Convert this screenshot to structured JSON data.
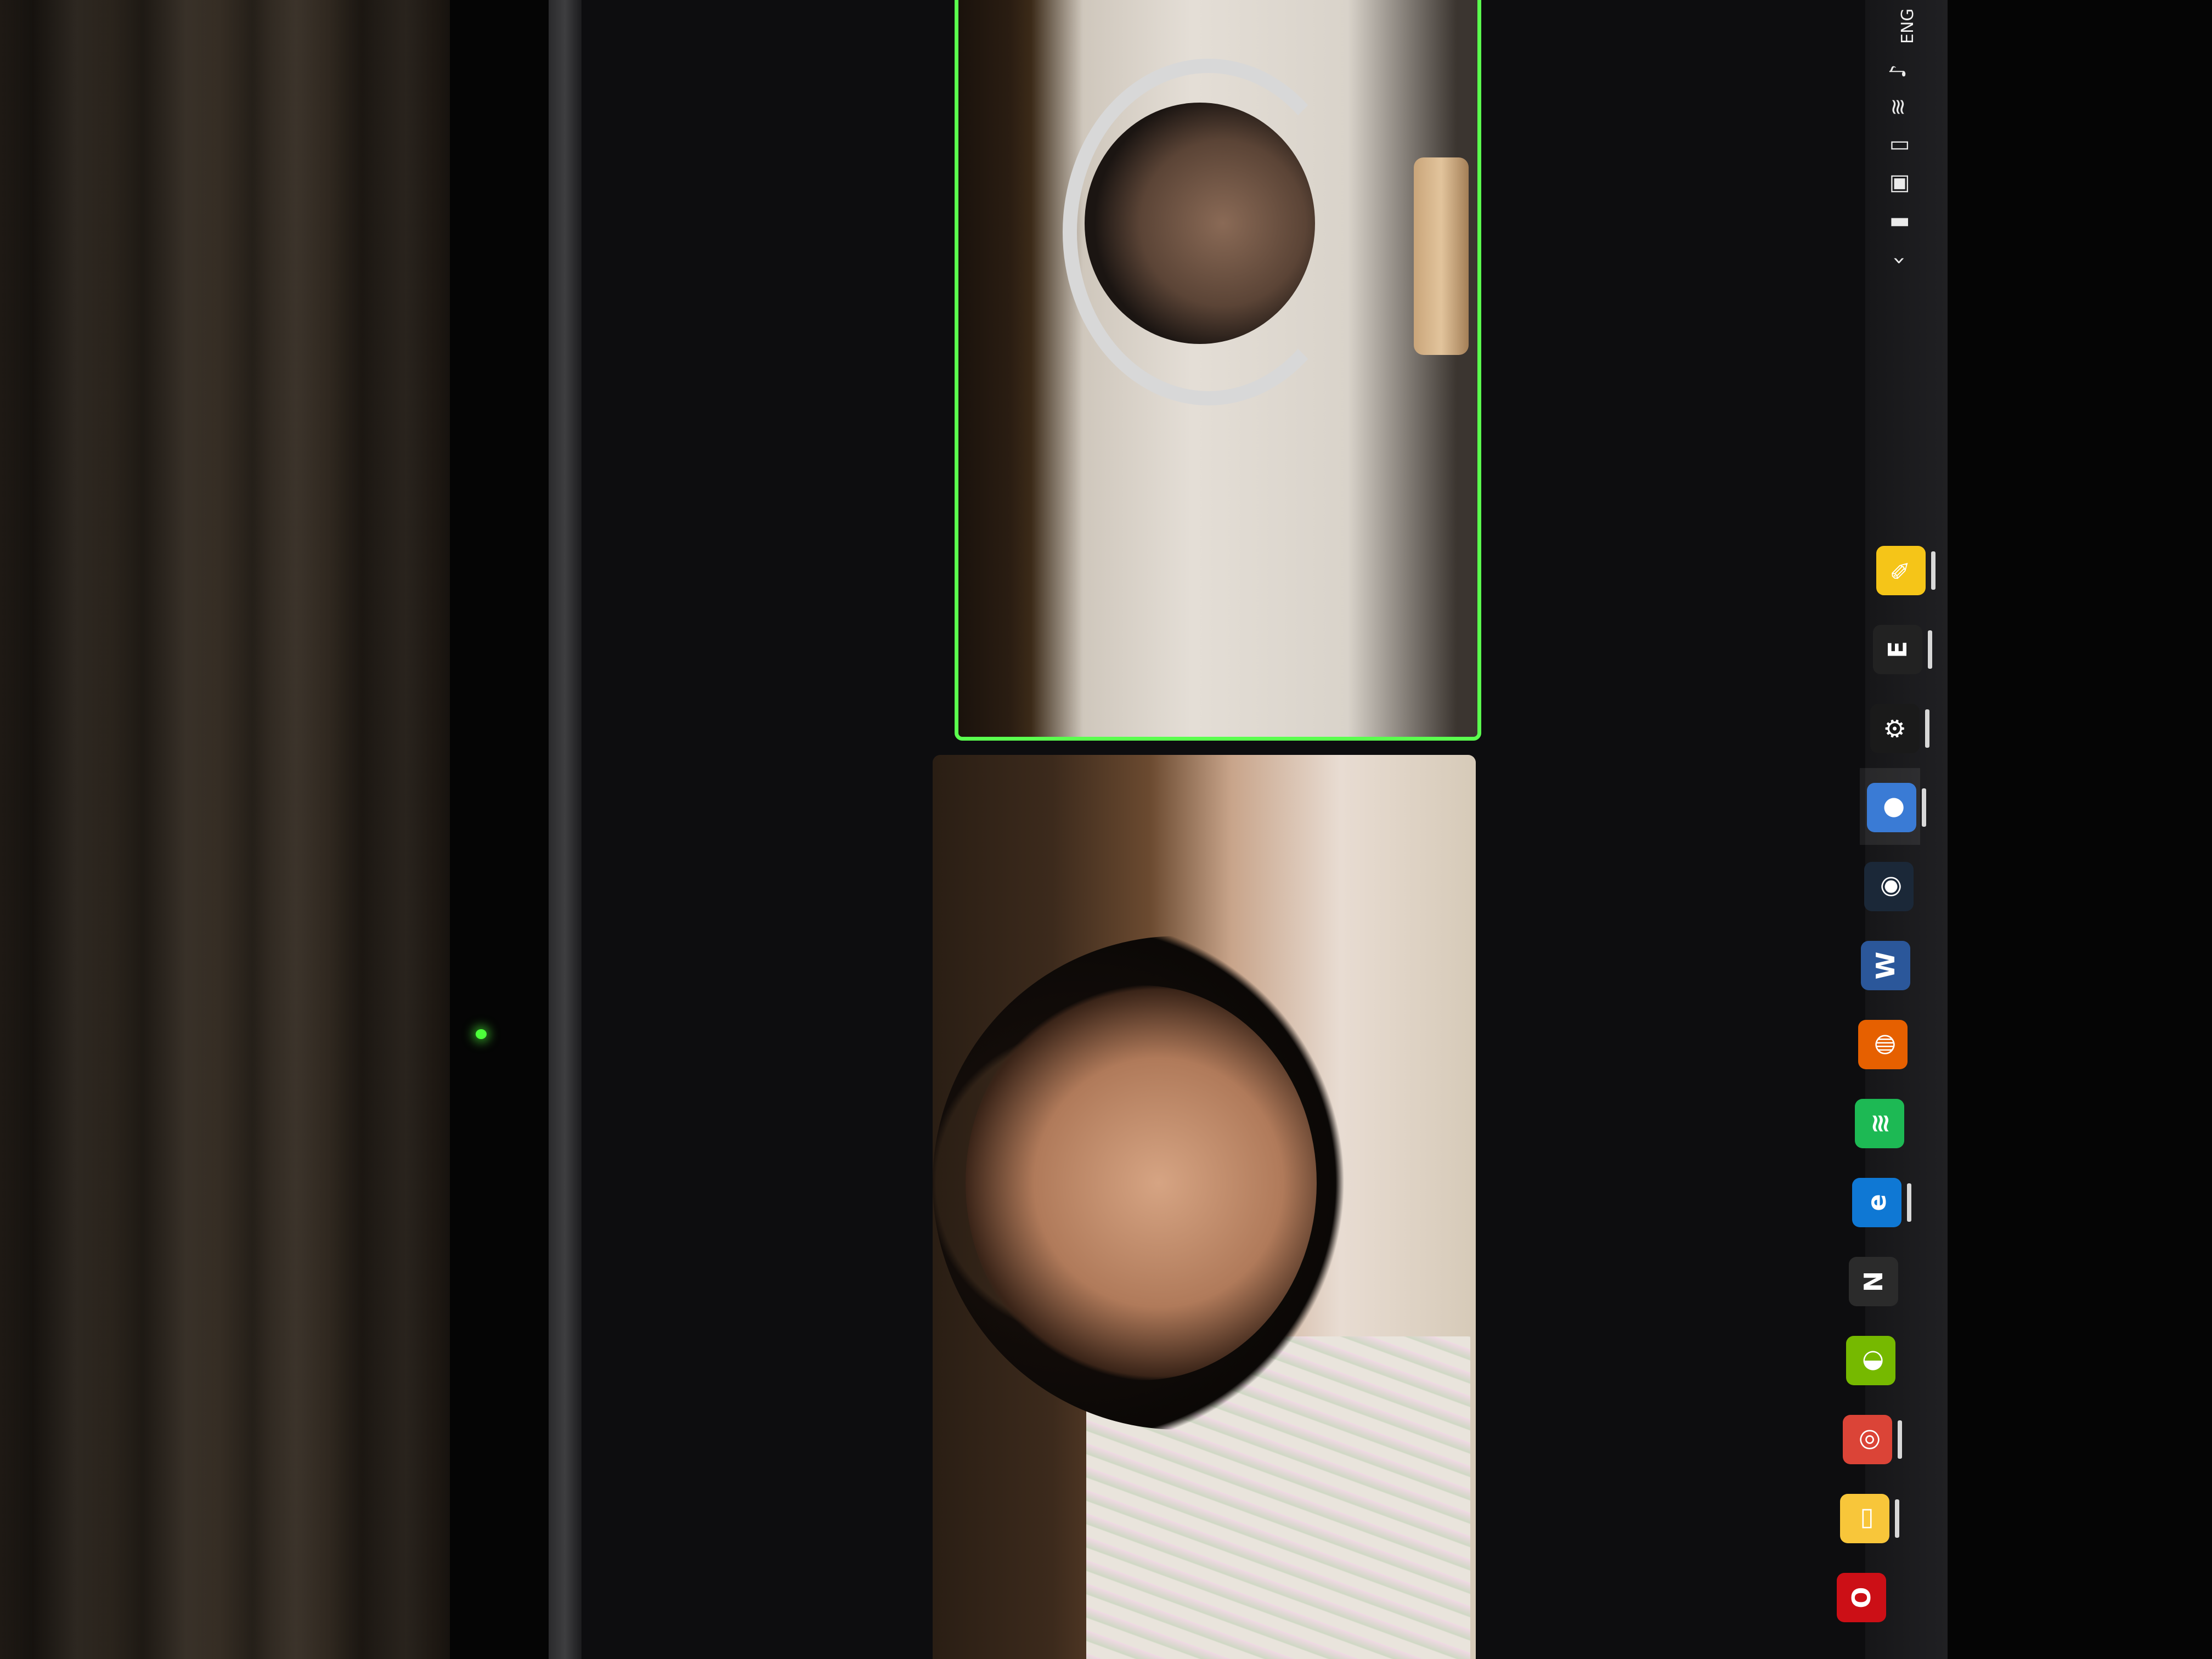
{
  "tray": {
    "language": "ENG",
    "icons": [
      "volume-icon",
      "wifi-icon",
      "usb-drive-icon",
      "camera-icon",
      "battery-icon",
      "chevron-up-icon"
    ]
  },
  "taskbar": {
    "apps": [
      {
        "name": "Sticky Notes",
        "icon": "sticky-notes-icon",
        "glyph": "✎",
        "color": "#f5c518",
        "pinned_indicator": true
      },
      {
        "name": "Epic Games",
        "icon": "epic-games-icon",
        "glyph": "E",
        "color": "#222222",
        "pinned_indicator": true
      },
      {
        "name": "Settings",
        "icon": "settings-icon",
        "glyph": "⚙",
        "color": "#1a1a1a",
        "pinned_indicator": true
      },
      {
        "name": "Zoom",
        "icon": "zoom-icon",
        "glyph": "●",
        "color": "#3a7bd5",
        "pinned_indicator": true
      },
      {
        "name": "Steam",
        "icon": "steam-icon",
        "glyph": "◉",
        "color": "#1b2838",
        "pinned_indicator": false
      },
      {
        "name": "Word",
        "icon": "word-icon",
        "glyph": "W",
        "color": "#2b579a",
        "pinned_indicator": false
      },
      {
        "name": "Firefox",
        "icon": "firefox-icon",
        "glyph": "◍",
        "color": "#e66000",
        "pinned_indicator": false
      },
      {
        "name": "Spotify",
        "icon": "spotify-icon",
        "glyph": "≋",
        "color": "#1db954",
        "pinned_indicator": false
      },
      {
        "name": "Edge",
        "icon": "edge-icon",
        "glyph": "e",
        "color": "#0f78d4",
        "pinned_indicator": true
      },
      {
        "name": "Notion",
        "icon": "notion-icon",
        "glyph": "N",
        "color": "#2b2b2b",
        "pinned_indicator": false
      },
      {
        "name": "NVIDIA",
        "icon": "nvidia-icon",
        "glyph": "◐",
        "color": "#76b900",
        "pinned_indicator": false
      },
      {
        "name": "Chrome",
        "icon": "chrome-icon",
        "glyph": "◎",
        "color": "#db4437",
        "pinned_indicator": true
      },
      {
        "name": "File Explorer",
        "icon": "file-explorer-icon",
        "glyph": "▭",
        "color": "#f8c63a",
        "pinned_indicator": true
      },
      {
        "name": "Opera",
        "icon": "opera-icon",
        "glyph": "O",
        "color": "#cc0f16",
        "pinned_indicator": false
      }
    ]
  },
  "meeting": {
    "participants": [
      {
        "tile": "video-tile-active-speaker",
        "speaking": true
      },
      {
        "tile": "video-tile-participant",
        "speaking": false
      }
    ],
    "accent": "#5aff4e"
  }
}
